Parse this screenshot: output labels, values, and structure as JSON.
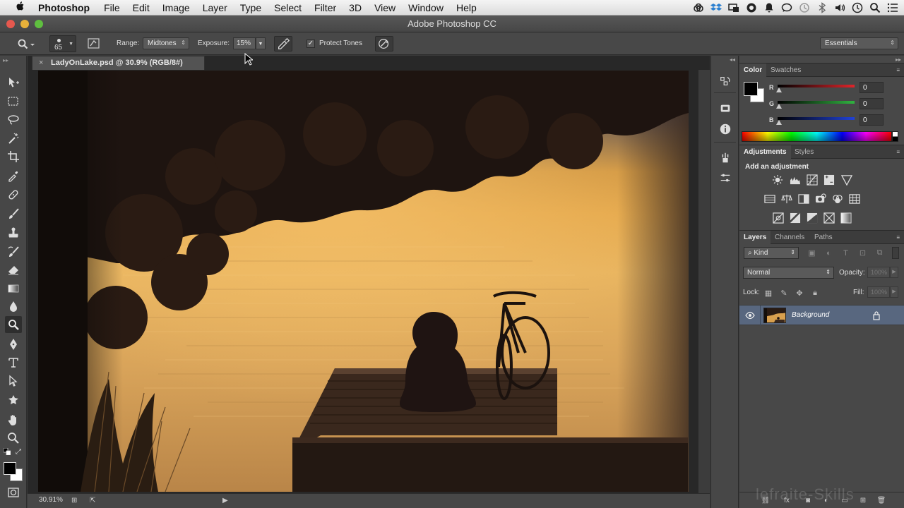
{
  "menubar": {
    "app_name": "Photoshop",
    "items": [
      "File",
      "Edit",
      "Image",
      "Layer",
      "Type",
      "Select",
      "Filter",
      "3D",
      "View",
      "Window",
      "Help"
    ],
    "tray_icons": [
      "creative-cloud-icon",
      "dropbox-icon",
      "screen-mirror-icon",
      "nvidia-icon",
      "notification-icon",
      "messages-icon",
      "time-machine-icon",
      "bluetooth-icon",
      "volume-icon",
      "clock-icon",
      "spotlight-icon",
      "notification-center-icon"
    ]
  },
  "window": {
    "title": "Adobe Photoshop CC"
  },
  "options": {
    "brush_size": "65",
    "range_label": "Range:",
    "range_value": "Midtones",
    "exposure_label": "Exposure:",
    "exposure_value": "15%",
    "protect_tones_label": "Protect Tones",
    "protect_tones_checked": true,
    "workspace": "Essentials"
  },
  "document": {
    "tab_title": "LadyOnLake.psd @ 30.9% (RGB/8#)",
    "zoom": "30.91%"
  },
  "color_panel": {
    "tabs": [
      "Color",
      "Swatches"
    ],
    "sliders": [
      {
        "label": "R",
        "value": "0",
        "color": "#e0242a"
      },
      {
        "label": "G",
        "value": "0",
        "color": "#30b340"
      },
      {
        "label": "B",
        "value": "0",
        "color": "#2142d6"
      }
    ],
    "foreground": "#000000",
    "background": "#ffffff"
  },
  "adjustments_panel": {
    "tabs": [
      "Adjustments",
      "Styles"
    ],
    "heading": "Add an adjustment"
  },
  "layers_panel": {
    "tabs": [
      "Layers",
      "Channels",
      "Paths"
    ],
    "filter_kind": "Kind",
    "blend_mode": "Normal",
    "opacity_label": "Opacity:",
    "opacity_value": "100%",
    "lock_label": "Lock:",
    "fill_label": "Fill:",
    "fill_value": "100%",
    "layers": [
      {
        "name": "Background",
        "locked": true,
        "visible": true
      }
    ]
  },
  "watermark": "lefraite-Skills"
}
